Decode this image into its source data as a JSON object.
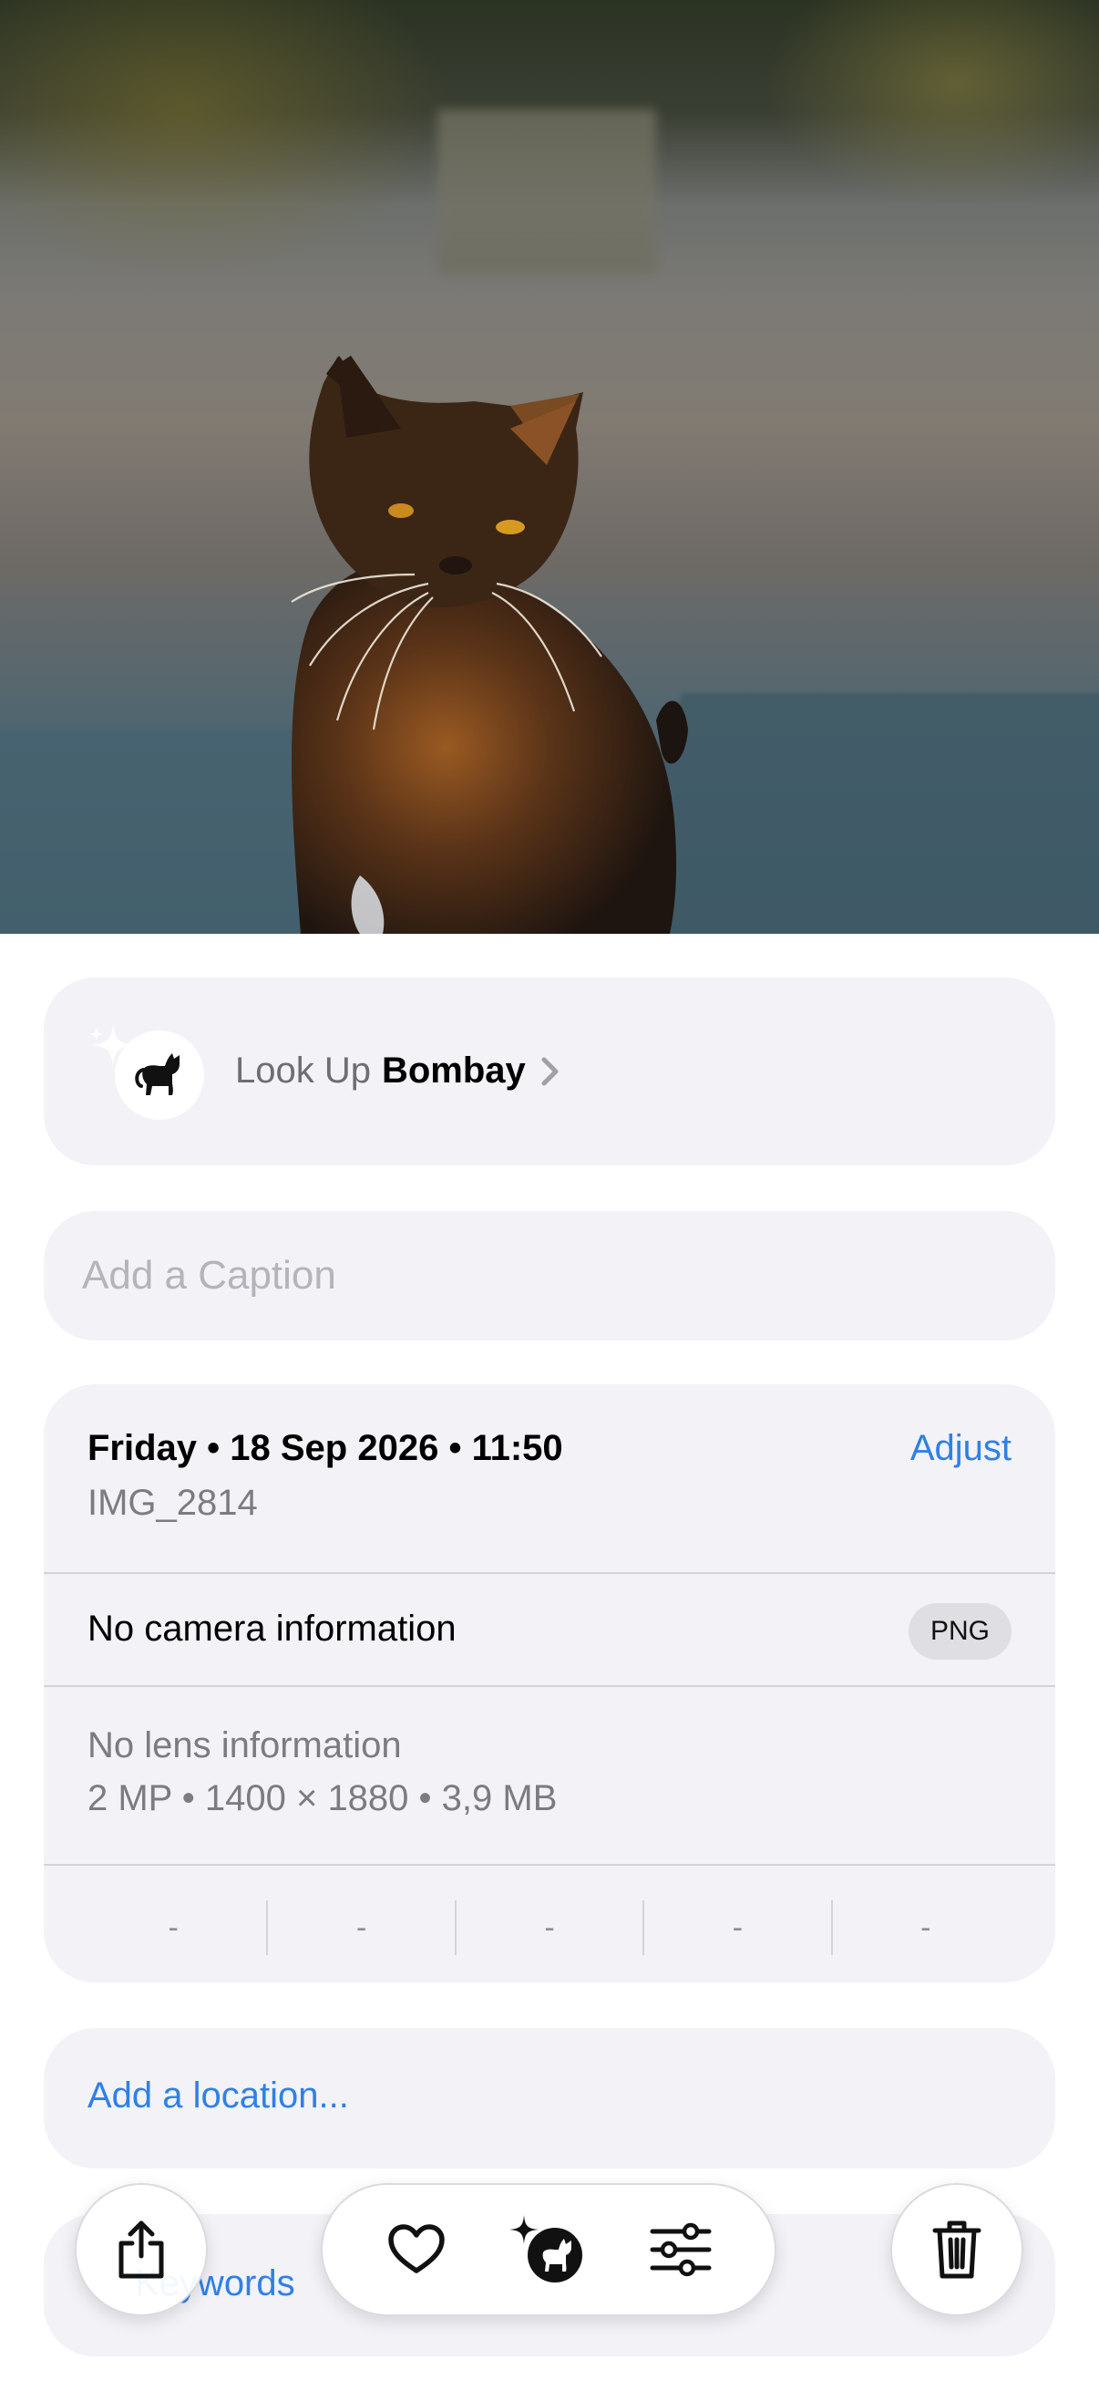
{
  "lookup": {
    "prefix": "Look Up",
    "subject": "Bombay"
  },
  "caption": {
    "placeholder": "Add a Caption"
  },
  "info": {
    "date": "Friday • 18 Sep 2026 • 11:50",
    "filename": "IMG_2814",
    "adjust_label": "Adjust",
    "camera": "No camera information",
    "format_badge": "PNG",
    "lens": "No lens information",
    "specs": "2 MP  •  1400 × 1880  •  3,9 MB",
    "exif": [
      "-",
      "-",
      "-",
      "-",
      "-"
    ]
  },
  "location": {
    "label": "Add a location..."
  },
  "keywords": {
    "label": "Keywords"
  },
  "toolbar": {
    "icons": [
      "share-icon",
      "heart-icon",
      "visual-lookup-icon",
      "adjust-sliders-icon",
      "trash-icon"
    ]
  },
  "colors": {
    "accent": "#2f80e6",
    "panel": "#f2f2f7"
  }
}
